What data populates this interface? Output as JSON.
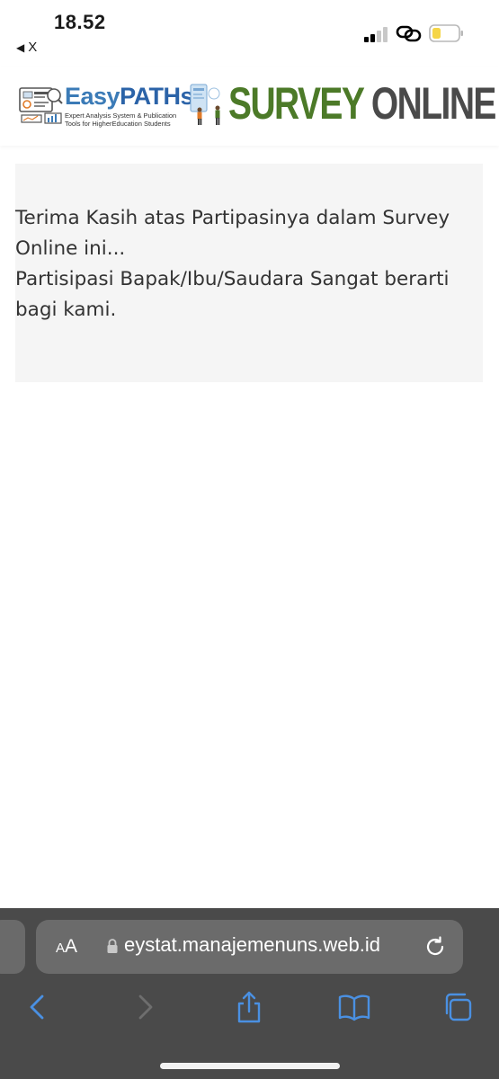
{
  "status_bar": {
    "time": "18.52",
    "back_app_label": "X"
  },
  "header": {
    "brand_name_easy": "Easy",
    "brand_name_paths": "PATHs",
    "brand_tagline_line1": "Expert Analysis System & Publication",
    "brand_tagline_line2": "Tools for HigherEducation Students",
    "title_word1": "SURVEY",
    "title_word2": "ONLINE"
  },
  "message": {
    "line1": "Terima Kasih atas Partipasinya dalam Survey Online ini...",
    "line2": "Partisipasi Bapak/Ibu/Saudara Sangat berarti bagi kami."
  },
  "browser": {
    "aa_label_small": "A",
    "aa_label_large": "A",
    "url": "eystat.manajemenuns.web.id"
  },
  "colors": {
    "survey_green": "#4c7a28",
    "online_gray": "#4a4a4a",
    "brand_blue": "#3b7bb7",
    "toolbar_blue": "#4a90e2",
    "battery_yellow": "#f5d547"
  },
  "icons": [
    "signal-icon",
    "link-icon",
    "battery-icon",
    "lock-icon",
    "reload-icon",
    "back-icon",
    "forward-icon",
    "share-icon",
    "bookmarks-icon",
    "tabs-icon"
  ]
}
